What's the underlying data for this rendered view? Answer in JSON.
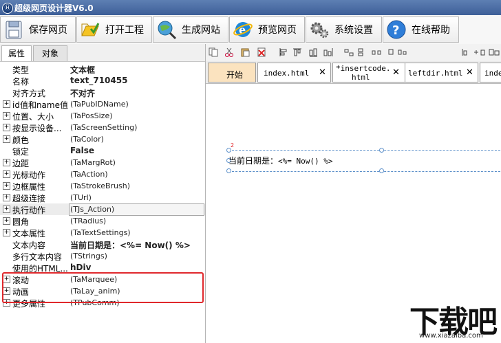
{
  "window": {
    "title": "超级网页设计器V6.0"
  },
  "toolbar": {
    "buttons": [
      {
        "label": "保存网页",
        "icon": "save-icon"
      },
      {
        "label": "打开工程",
        "icon": "folder-open-icon"
      },
      {
        "label": "生成网站",
        "icon": "globe-search-icon"
      },
      {
        "label": "预览网页",
        "icon": "ie-browser-icon"
      },
      {
        "label": "系统设置",
        "icon": "gears-icon"
      },
      {
        "label": "在线帮助",
        "icon": "help-icon"
      }
    ]
  },
  "left_panel": {
    "tabs": [
      {
        "label": "属性"
      },
      {
        "label": "对象"
      }
    ],
    "properties": [
      {
        "name": "类型",
        "value": "文本框",
        "expandable": false,
        "bold": true
      },
      {
        "name": "名称",
        "value": "text_710455",
        "expandable": false,
        "bold": true
      },
      {
        "name": "对齐方式",
        "value": "不对齐",
        "expandable": false,
        "bold": true
      },
      {
        "name": "id值和name值",
        "value": "(TaPubIDName)",
        "expandable": true,
        "bold": false
      },
      {
        "name": "位置、大小",
        "value": "(TaPosSize)",
        "expandable": true,
        "bold": false
      },
      {
        "name": "按显示设备...",
        "value": "(TaScreenSetting)",
        "expandable": true,
        "bold": false
      },
      {
        "name": "颜色",
        "value": "(TaColor)",
        "expandable": true,
        "bold": false
      },
      {
        "name": "锁定",
        "value": "False",
        "expandable": false,
        "bold": true
      },
      {
        "name": "边距",
        "value": "(TaMargRot)",
        "expandable": true,
        "bold": false
      },
      {
        "name": "光标动作",
        "value": "(TaAction)",
        "expandable": true,
        "bold": false
      },
      {
        "name": "边框属性",
        "value": "(TaStrokeBrush)",
        "expandable": true,
        "bold": false
      },
      {
        "name": "超级连接",
        "value": "(TUrl)",
        "expandable": true,
        "bold": false
      },
      {
        "name": "执行动作",
        "value": "(TJs_Action)",
        "expandable": true,
        "bold": false
      },
      {
        "name": "圆角",
        "value": "(TRadius)",
        "expandable": true,
        "bold": false
      },
      {
        "name": "文本属性",
        "value": "(TaTextSettings)",
        "expandable": true,
        "bold": false
      },
      {
        "name": "文本内容",
        "value": "当前日期是：<%= Now() %>",
        "expandable": false,
        "bold": true
      },
      {
        "name": "多行文本内容",
        "value": "(TStrings)",
        "expandable": false,
        "bold": false
      },
      {
        "name": "使用的HTML...",
        "value": "hDiv",
        "expandable": false,
        "bold": true
      },
      {
        "name": "滚动",
        "value": "(TaMarquee)",
        "expandable": true,
        "bold": false
      },
      {
        "name": "动画",
        "value": "(TaLay_anim)",
        "expandable": true,
        "bold": false
      },
      {
        "name": "更多属性",
        "value": "(TPubComm)",
        "expandable": true,
        "bold": false
      }
    ]
  },
  "editor": {
    "doc_tabs": [
      {
        "label": "开始"
      },
      {
        "label": "index.html"
      },
      {
        "label": "*insertcode.",
        "label2": "html"
      },
      {
        "label": "leftdir.html"
      },
      {
        "label": "inde"
      }
    ],
    "canvas_text": "当前日期是：",
    "canvas_code": "<%= Now() %>",
    "marker": "2"
  },
  "watermark": {
    "big": "下载吧",
    "small": "www.xiazaiba.com"
  },
  "colors": {
    "highlight_box": "#e0282c",
    "selection": "#5b8fc9"
  }
}
